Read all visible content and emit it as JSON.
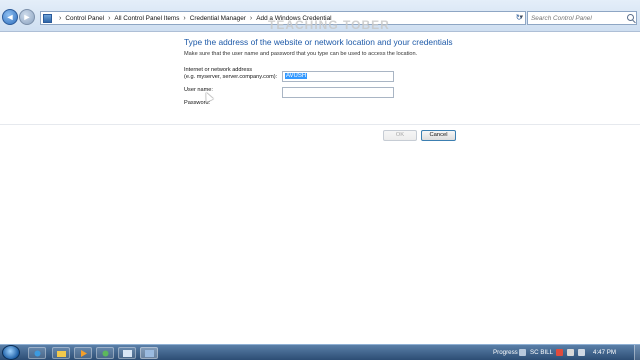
{
  "window": {
    "watermark": "TEACHING TOBER"
  },
  "address_bar": {
    "breadcrumbs": [
      "Control Panel",
      "All Control Panel Items",
      "Credential Manager",
      "Add a Windows Credential"
    ],
    "search_placeholder": "Search Control Panel"
  },
  "form": {
    "heading": "Type the address of the website or network location and your credentials",
    "subtext": "Make sure that the user name and password that you type can be used to access the location.",
    "address_label_line1": "Internet or network address",
    "address_label_line2": "(e.g. myserver, server.company.com):",
    "address_value": "AVUSH",
    "username_label": "User name:",
    "username_value": "",
    "password_label": "Password:"
  },
  "buttons": {
    "ok": "OK",
    "cancel": "Cancel"
  },
  "taskbar": {
    "tray_label_1": "Progress",
    "tray_label_2": "SC BILL",
    "clock": "4:47 PM"
  },
  "colors": {
    "heading": "#1e5aa8",
    "selection": "#3399ff",
    "taskbar": "#2c4d74"
  }
}
